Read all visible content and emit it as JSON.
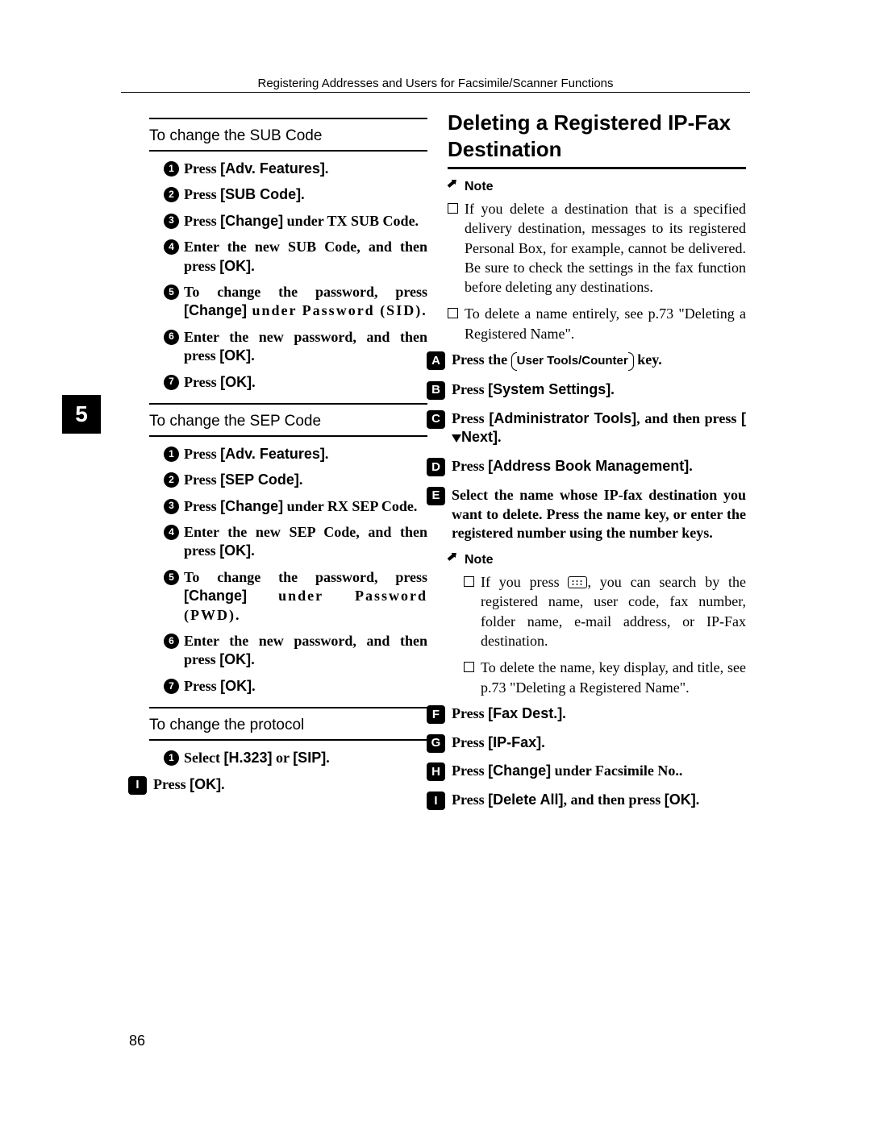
{
  "header": "Registering Addresses and Users for Facsimile/Scanner Functions",
  "tab_number": "5",
  "page_number": "86",
  "left": {
    "sec1_title": "To change the SUB Code",
    "sec1": {
      "i1": {
        "pre": "Press ",
        "b": "[Adv. Features]",
        "post": "."
      },
      "i2": {
        "pre": "Press ",
        "b": "[SUB Code]",
        "post": "."
      },
      "i3": {
        "pre": "Press ",
        "b": "[Change]",
        "post": " under TX SUB Code."
      },
      "i4": {
        "pre": "Enter the new SUB Code, and then press ",
        "b": "[OK]",
        "post": "."
      },
      "i5": {
        "pre": "To change the password, press ",
        "b": "[Change]",
        "post": " under Password (SID)."
      },
      "i6": {
        "pre": "Enter the new password, and then press ",
        "b": "[OK]",
        "post": "."
      },
      "i7": {
        "pre": "Press ",
        "b": "[OK]",
        "post": "."
      }
    },
    "sec2_title": "To change the SEP Code",
    "sec2": {
      "i1": {
        "pre": "Press ",
        "b": "[Adv. Features]",
        "post": "."
      },
      "i2": {
        "pre": "Press ",
        "b": "[SEP Code]",
        "post": "."
      },
      "i3": {
        "pre": "Press ",
        "b": "[Change]",
        "post": " under RX SEP Code."
      },
      "i4": {
        "pre": "Enter the new SEP Code, and then press ",
        "b": "[OK]",
        "post": "."
      },
      "i5": {
        "pre": "To change the password, press ",
        "b": "[Change]",
        "post": " under Password (PWD)."
      },
      "i6": {
        "pre": "Enter the new password, and then press ",
        "b": "[OK]",
        "post": "."
      },
      "i7": {
        "pre": "Press ",
        "b": "[OK]",
        "post": "."
      }
    },
    "sec3_title": "To change the protocol",
    "sec3": {
      "i1": {
        "pre": "Select ",
        "b1": "[H.323]",
        "mid": " or ",
        "b2": "[SIP]",
        "post": "."
      }
    },
    "bigI": {
      "pre": "Press ",
      "b": "[OK]",
      "post": "."
    }
  },
  "right": {
    "heading": "Deleting a Registered IP-Fax Destination",
    "note_label": "Note",
    "note1": "If you delete a destination that is a specified delivery destination, messages to its registered Personal Box, for example, cannot be delivered. Be sure to check the settings in the fax function before deleting any destinations.",
    "note2": "To delete a name entirely, see p.73 \"Deleting a Registered Name\".",
    "sA": {
      "pre": "Press the ",
      "key": "User Tools/Counter",
      "post": " key."
    },
    "sB": {
      "pre": "Press ",
      "b": "[System Settings]",
      "post": "."
    },
    "sC": {
      "pre": "Press ",
      "b": "[Administrator Tools]",
      "mid": ", and then press ",
      "b2": "[",
      "tri": "▼",
      "b2b": "Next]",
      "post": "."
    },
    "sD": {
      "pre": "Press ",
      "b": "[Address Book Management]",
      "post": "."
    },
    "sE": "Select the name whose IP-fax destination you want to delete. Press the name key, or enter the registered number using the number keys.",
    "inner_note_label": "Note",
    "inner_note1a": "If you press ",
    "inner_note1b": ", you can search by the registered name, user code, fax number, folder name, e-mail address, or IP-Fax destination.",
    "inner_note2": "To delete the name, key display, and title, see p.73 \"Deleting a Registered Name\".",
    "sF": {
      "pre": "Press ",
      "b": "[Fax Dest.]",
      "post": "."
    },
    "sG": {
      "pre": "Press ",
      "b": "[IP-Fax]",
      "post": "."
    },
    "sH": {
      "pre": "Press ",
      "b": "[Change]",
      "post": " under Facsimile No.."
    },
    "sI": {
      "pre": "Press ",
      "b": "[Delete All]",
      "mid": ", and then press ",
      "b2": "[OK]",
      "post": "."
    }
  }
}
